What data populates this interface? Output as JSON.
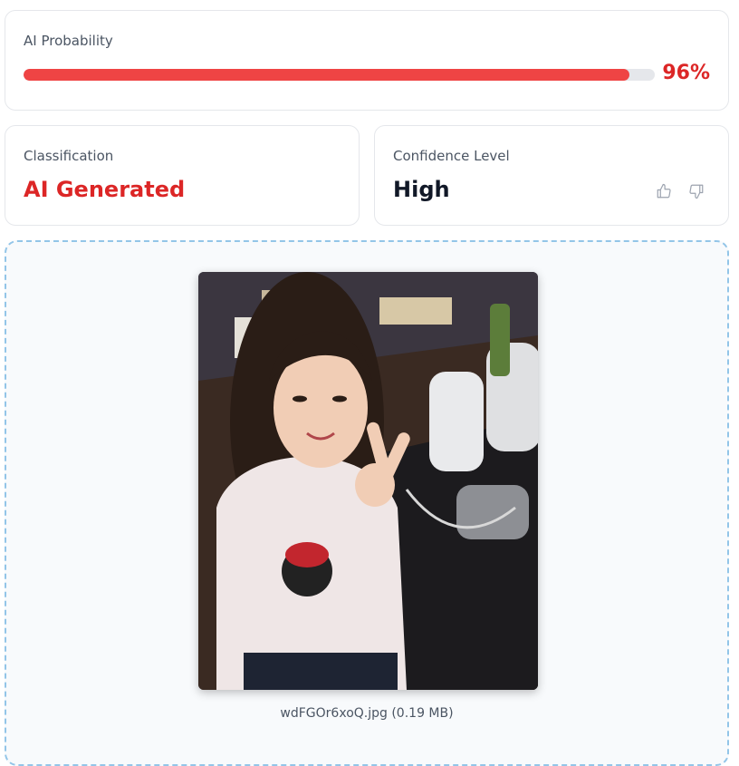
{
  "probability": {
    "label": "AI Probability",
    "value_text": "96%",
    "value": 96,
    "color": "#ef4444"
  },
  "classification": {
    "label": "Classification",
    "value": "AI Generated",
    "color": "#dc2626"
  },
  "confidence": {
    "label": "Confidence Level",
    "value": "High",
    "feedback_icons": [
      "thumbs-up-icon",
      "thumbs-down-icon"
    ]
  },
  "upload": {
    "file_name": "wdFGOr6xoQ.jpg",
    "file_size": "(0.19 MB)",
    "file_caption": "wdFGOr6xoQ.jpg (0.19 MB)"
  }
}
